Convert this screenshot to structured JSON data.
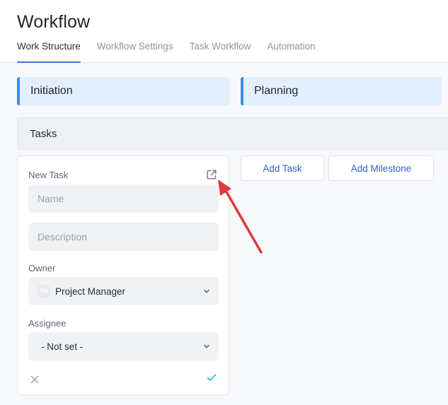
{
  "header": {
    "title": "Workflow",
    "tabs": [
      {
        "label": "Work Structure",
        "active": true
      },
      {
        "label": "Workflow Settings",
        "active": false
      },
      {
        "label": "Task Workflow",
        "active": false
      },
      {
        "label": "Automation",
        "active": false
      }
    ]
  },
  "phases": [
    {
      "label": "Initiation"
    },
    {
      "label": "Planning"
    }
  ],
  "tasks_section": {
    "title": "Tasks"
  },
  "new_task_form": {
    "title": "New Task",
    "name_placeholder": "Name",
    "description_placeholder": "Description",
    "owner_label": "Owner",
    "owner_avatar": "PM",
    "owner_value": "Project Manager",
    "assignee_label": "Assignee",
    "assignee_value": "- Not set -"
  },
  "actions": {
    "add_task": "Add Task",
    "add_milestone": "Add Milestone"
  },
  "icons": {
    "open": "external-link-icon",
    "cancel": "close-icon",
    "confirm": "check-icon",
    "chevron": "chevron-down-icon"
  },
  "colors": {
    "accent": "#3b6fd8",
    "phase_background": "#e3effd",
    "phase_border": "#3b8ee8",
    "link_text": "#2d5fc9",
    "confirm_teal": "#1fb6c9",
    "annotation_arrow": "#e0393e"
  }
}
